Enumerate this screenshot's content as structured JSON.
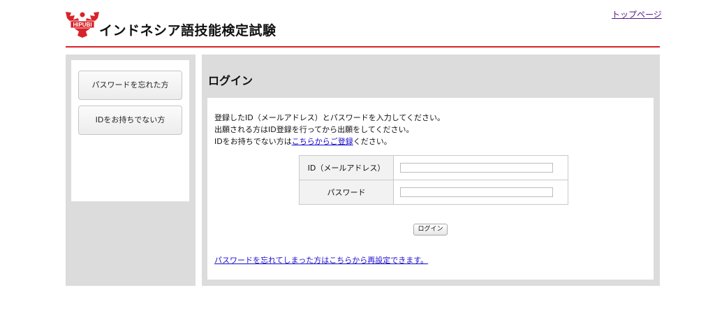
{
  "header": {
    "logo_text": "HIPUBI",
    "site_title": "インドネシア語技能検定試験",
    "top_page_link": "トップページ"
  },
  "colors": {
    "brand_red": "#d9232a",
    "panel_gray": "#dcdcdc",
    "link_blue": "#1a0dcc",
    "visited_link": "#551a8b"
  },
  "sidebar": {
    "forgot_password_button": "パスワードを忘れた方",
    "no_id_button": "IDをお持ちでない方"
  },
  "main": {
    "title": "ログイン",
    "instruction_line1": "登録したID（メールアドレス）とパスワードを入力してください。",
    "instruction_line2": "出願される方はID登録を行ってから出願をしてください。",
    "instruction_line3_prefix": "IDをお持ちでない方は",
    "instruction_line3_link": "こちらからご登録",
    "instruction_line3_suffix": "ください。",
    "form": {
      "id_label": "ID（メールアドレス）",
      "id_value": "",
      "password_label": "パスワード",
      "password_value": ""
    },
    "login_button": "ログイン",
    "reset_link": "パスワードを忘れてしまった方はこちらから再設定できます。"
  }
}
